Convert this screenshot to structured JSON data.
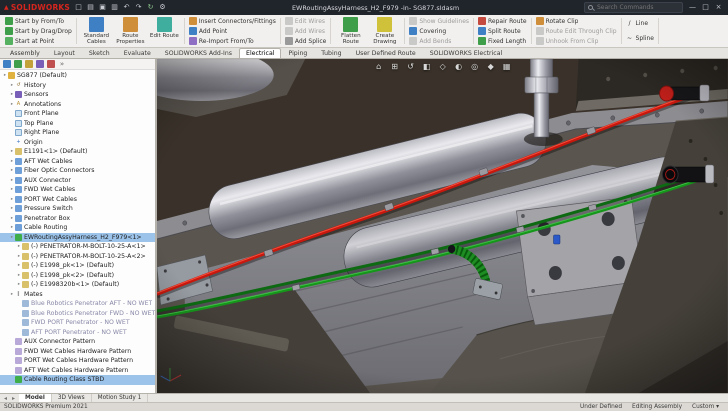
{
  "colors": {
    "accent_blue": "#2f7bc4",
    "selection_blue": "#9cc3ea",
    "cable_red": "#c8170c",
    "cable_green": "#17961c",
    "viewport_brown": "#3a322a",
    "logo_red": "#d6261e"
  },
  "titlebar": {
    "logo": "SOLIDWORKS",
    "quick_access": [
      "new-document",
      "open",
      "save",
      "print",
      "undo",
      "redo",
      "rebuild",
      "options"
    ],
    "document_title": "EWRoutingAssyHarness_H2_F979 -in- SG877.sldasm",
    "search": {
      "placeholder": "Search Commands"
    },
    "window_controls": [
      "minimize",
      "maximize",
      "close"
    ]
  },
  "ribbon": {
    "groups": [
      {
        "type": "stack",
        "buttons": [
          {
            "label": "Start by From/To",
            "icon": "start-by-from-to",
            "enabled": true
          },
          {
            "label": "Start by Drag/Drop",
            "icon": "start-by-drag-drop",
            "enabled": true
          },
          {
            "label": "Start at Point",
            "icon": "start-at-point",
            "enabled": true
          }
        ]
      },
      {
        "type": "large",
        "buttons": [
          {
            "label": "Standard Cables",
            "icon": "standard-cables",
            "enabled": true
          },
          {
            "label": "Route Properties",
            "icon": "route-properties",
            "enabled": true
          },
          {
            "label": "Edit Route",
            "icon": "edit-route",
            "enabled": true
          }
        ]
      },
      {
        "type": "stack",
        "buttons": [
          {
            "label": "Insert Connectors/Fittings",
            "icon": "insert-connectors",
            "enabled": true
          },
          {
            "label": "Add Point",
            "icon": "add-point",
            "enabled": true
          },
          {
            "label": "Re-Import From/To",
            "icon": "reimport-from-to",
            "enabled": true
          }
        ]
      },
      {
        "type": "stack",
        "buttons": [
          {
            "label": "Edit Wires",
            "icon": "edit-wires",
            "enabled": false
          },
          {
            "label": "Add Wires",
            "icon": "add-wires",
            "enabled": false
          },
          {
            "label": "Add Splice",
            "icon": "add-splice",
            "enabled": true
          }
        ]
      },
      {
        "type": "large",
        "buttons": [
          {
            "label": "Flatten Route",
            "icon": "flatten-route",
            "enabled": true
          },
          {
            "label": "Create Drawing",
            "icon": "create-drawing",
            "enabled": true
          }
        ]
      },
      {
        "type": "stack",
        "buttons": [
          {
            "label": "Show Guidelines",
            "icon": "show-guidelines",
            "enabled": false
          },
          {
            "label": "Covering",
            "icon": "covering",
            "enabled": true
          },
          {
            "label": "Add Bends",
            "icon": "add-bends",
            "enabled": false
          }
        ]
      },
      {
        "type": "stack",
        "buttons": [
          {
            "label": "Repair Route",
            "icon": "repair-route",
            "enabled": true
          },
          {
            "label": "Split Route",
            "icon": "split-route",
            "enabled": true
          },
          {
            "label": "Fixed Length",
            "icon": "fixed-length",
            "enabled": true
          }
        ]
      },
      {
        "type": "stack",
        "buttons": [
          {
            "label": "Rotate Clip",
            "icon": "rotate-clip",
            "enabled": true
          },
          {
            "label": "Route Edit Through Clip",
            "icon": "route-through-clip",
            "enabled": false
          },
          {
            "label": "Unhook From Clip",
            "icon": "unhook-from-clip",
            "enabled": false
          }
        ]
      },
      {
        "type": "stack",
        "buttons": [
          {
            "label": "Line",
            "icon": "line",
            "enabled": true
          },
          {
            "label": "Spline",
            "icon": "spline",
            "enabled": true
          }
        ]
      }
    ]
  },
  "command_tabs": {
    "items": [
      {
        "label": "Assembly"
      },
      {
        "label": "Layout"
      },
      {
        "label": "Sketch"
      },
      {
        "label": "Evaluate"
      },
      {
        "label": "SOLIDWORKS Add-Ins"
      },
      {
        "label": "Electrical",
        "active": true
      },
      {
        "label": "Piping"
      },
      {
        "label": "Tubing"
      },
      {
        "label": "User Defined Route"
      },
      {
        "label": "SOLIDWORKS Electrical"
      }
    ]
  },
  "feature_tree": {
    "panel_tabs": [
      "featuremanager-tree",
      "propertymanager",
      "configurationmanager",
      "dimxpertmanager",
      "displaymanager",
      "pane-collapse"
    ],
    "items": [
      {
        "label": "SG877 (Default)",
        "icon": "assembly",
        "caret": true,
        "indent": 0
      },
      {
        "label": "History",
        "icon": "history",
        "caret": true,
        "indent": 1
      },
      {
        "label": "Sensors",
        "icon": "sensors",
        "caret": true,
        "indent": 1
      },
      {
        "label": "Annotations",
        "icon": "annotations",
        "caret": true,
        "indent": 1
      },
      {
        "label": "Front Plane",
        "icon": "plane",
        "indent": 1
      },
      {
        "label": "Top Plane",
        "icon": "plane",
        "indent": 1
      },
      {
        "label": "Right Plane",
        "icon": "plane",
        "indent": 1
      },
      {
        "label": "Origin",
        "icon": "origin",
        "indent": 1
      },
      {
        "label": "E1191<1> (Default)",
        "icon": "part",
        "caret": true,
        "indent": 1
      },
      {
        "label": "AFT Wet Cables",
        "icon": "folder",
        "caret": true,
        "indent": 1
      },
      {
        "label": "Fiber Optic Connectors",
        "icon": "folder",
        "caret": true,
        "indent": 1
      },
      {
        "label": "AUX Connector",
        "icon": "folder",
        "caret": true,
        "indent": 1
      },
      {
        "label": "FWD Wet Cables",
        "icon": "folder",
        "caret": true,
        "indent": 1
      },
      {
        "label": "PORT Wet Cables",
        "icon": "folder",
        "caret": true,
        "indent": 1
      },
      {
        "label": "Pressure Switch",
        "icon": "folder",
        "caret": true,
        "indent": 1
      },
      {
        "label": "Penetrator Box",
        "icon": "folder",
        "caret": true,
        "indent": 1
      },
      {
        "label": "Cable Routing",
        "icon": "folder",
        "caret": true,
        "indent": 1
      },
      {
        "label": "EWRoutingAssyHarness_H2_F979<1>",
        "icon": "route-assembly",
        "caret": true,
        "indent": 1,
        "selected": true
      },
      {
        "label": "(-) PENETRATOR-M-BOLT-10-25-A<1>",
        "icon": "part",
        "caret": true,
        "indent": 2
      },
      {
        "label": "(-) PENETRATOR-M-BOLT-10-25-A<2>",
        "icon": "part",
        "caret": true,
        "indent": 2
      },
      {
        "label": "(-) E1998_pk<1> (Default)",
        "icon": "part",
        "caret": true,
        "indent": 2
      },
      {
        "label": "(-) E1998_pk<2> (Default)",
        "icon": "part",
        "caret": true,
        "indent": 2
      },
      {
        "label": "(-) E1998320b<1> (Default)",
        "icon": "part",
        "caret": true,
        "indent": 2
      },
      {
        "label": "Mates",
        "icon": "mates",
        "caret": true,
        "indent": 1
      },
      {
        "label": "Blue Robotics Penetrator AFT - NO WET",
        "icon": "mate-ref",
        "indent": 2,
        "dim": true
      },
      {
        "label": "Blue Robotics Penetrator FWD - NO WET",
        "icon": "mate-ref",
        "indent": 2,
        "dim": true
      },
      {
        "label": "FWD PORT Penetrator - NO WET",
        "icon": "mate-ref",
        "indent": 2,
        "dim": true
      },
      {
        "label": "AFT PORT Penetrator - NO WET",
        "icon": "mate-ref",
        "indent": 2,
        "dim": true
      },
      {
        "label": "AUX Connector Pattern",
        "icon": "pattern",
        "indent": 1
      },
      {
        "label": "FWD Wet Cables Hardware Pattern",
        "icon": "pattern",
        "indent": 1
      },
      {
        "label": "PORT Wet Cables Hardware Pattern",
        "icon": "pattern",
        "indent": 1
      },
      {
        "label": "AFT Wet Cables Hardware Pattern",
        "icon": "pattern",
        "indent": 1
      },
      {
        "label": "Cable Routing Class STBD",
        "icon": "route-assembly",
        "indent": 1,
        "selected": true
      }
    ]
  },
  "viewport": {
    "hud_icons": [
      "zoom-fit",
      "zoom-area",
      "previous-view",
      "section-view",
      "view-orientation",
      "display-style",
      "hide-show",
      "edit-appearance",
      "scene-settings"
    ]
  },
  "bottom_tabs": {
    "nav_icons": [
      "tab-prev",
      "tab-next"
    ],
    "items": [
      {
        "label": "Model",
        "active": true
      },
      {
        "label": "3D Views"
      },
      {
        "label": "Motion Study 1"
      }
    ]
  },
  "statusbar": {
    "left": "SOLIDWORKS Premium 2021",
    "items": [
      "Under Defined",
      "Editing Assembly",
      "Custom ▾"
    ]
  }
}
